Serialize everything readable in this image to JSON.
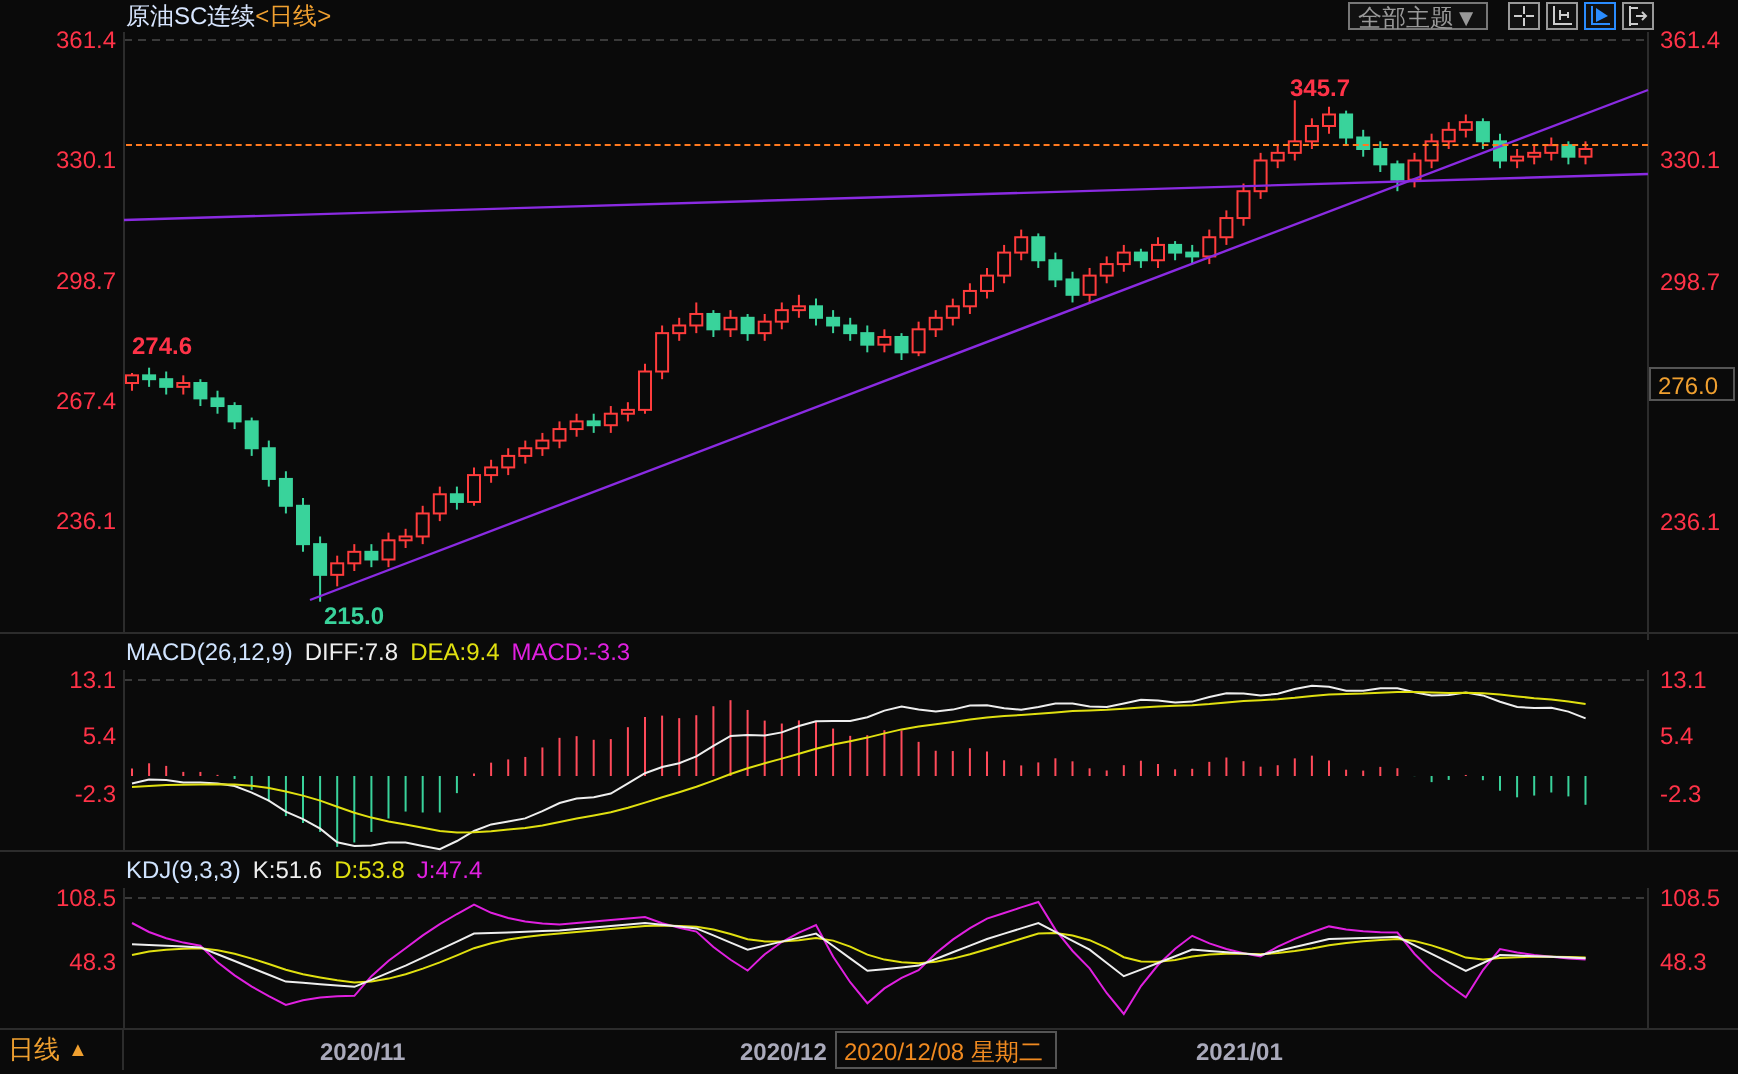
{
  "header": {
    "title": "原油SC连续",
    "period": "<日线>",
    "theme_button": "全部主题▼",
    "tools": [
      {
        "kind": "crosshair",
        "selected": false
      },
      {
        "kind": "axis",
        "selected": false
      },
      {
        "kind": "play",
        "selected": true
      },
      {
        "kind": "shift",
        "selected": false
      }
    ]
  },
  "price_panel": {
    "left_ticks": [
      "361.4",
      "330.1",
      "298.7",
      "267.4",
      "236.1"
    ],
    "right_ticks": [
      "361.4",
      "330.1",
      "298.7",
      "236.1"
    ],
    "current_price": "276.0",
    "chart_data": {
      "type": "candlestick",
      "ylim": [
        207.1,
        363.5
      ],
      "yticks": [
        361.4,
        330.1,
        298.7,
        267.4,
        236.1
      ],
      "ohlc": [
        [
          272,
          274.6,
          270,
          274
        ],
        [
          274,
          276,
          271,
          273
        ],
        [
          273,
          275,
          269,
          271
        ],
        [
          271,
          274,
          269,
          272
        ],
        [
          272,
          273,
          266,
          268
        ],
        [
          268,
          270,
          264,
          266
        ],
        [
          266,
          267,
          260,
          262
        ],
        [
          262,
          263,
          253,
          255
        ],
        [
          255,
          257,
          245,
          247
        ],
        [
          247,
          249,
          238,
          240
        ],
        [
          240,
          242,
          228,
          230
        ],
        [
          230,
          232,
          215,
          222
        ],
        [
          222,
          227,
          219,
          225
        ],
        [
          225,
          230,
          223,
          228
        ],
        [
          228,
          230,
          224,
          226
        ],
        [
          226,
          233,
          224,
          231
        ],
        [
          231,
          234,
          229,
          232
        ],
        [
          232,
          240,
          230,
          238
        ],
        [
          238,
          245,
          236,
          243
        ],
        [
          243,
          245,
          239,
          241
        ],
        [
          241,
          250,
          240,
          248
        ],
        [
          248,
          252,
          246,
          250
        ],
        [
          250,
          255,
          248,
          253
        ],
        [
          253,
          257,
          251,
          255
        ],
        [
          255,
          259,
          253,
          257
        ],
        [
          257,
          262,
          255,
          260
        ],
        [
          260,
          264,
          258,
          262
        ],
        [
          262,
          264,
          259,
          261
        ],
        [
          261,
          266,
          259,
          264
        ],
        [
          264,
          267,
          262,
          265
        ],
        [
          265,
          277,
          264,
          275
        ],
        [
          275,
          287,
          273,
          285
        ],
        [
          285,
          289,
          283,
          287
        ],
        [
          287,
          293,
          285,
          290
        ],
        [
          290,
          291,
          284,
          286
        ],
        [
          286,
          291,
          284,
          289
        ],
        [
          289,
          290,
          283,
          285
        ],
        [
          285,
          290,
          283,
          288
        ],
        [
          288,
          293,
          286,
          291
        ],
        [
          291,
          295,
          289,
          292
        ],
        [
          292,
          294,
          287,
          289
        ],
        [
          289,
          291,
          285,
          287
        ],
        [
          287,
          289,
          283,
          285
        ],
        [
          285,
          287,
          280,
          282
        ],
        [
          282,
          286,
          280,
          284
        ],
        [
          284,
          285,
          278,
          280
        ],
        [
          280,
          288,
          279,
          286
        ],
        [
          286,
          291,
          284,
          289
        ],
        [
          289,
          294,
          287,
          292
        ],
        [
          292,
          298,
          290,
          296
        ],
        [
          296,
          302,
          294,
          300
        ],
        [
          300,
          308,
          298,
          306
        ],
        [
          306,
          312,
          304,
          310
        ],
        [
          310,
          311,
          302,
          304
        ],
        [
          304,
          306,
          297,
          299
        ],
        [
          299,
          301,
          293,
          295
        ],
        [
          295,
          302,
          293,
          300
        ],
        [
          300,
          305,
          298,
          303
        ],
        [
          303,
          308,
          301,
          306
        ],
        [
          306,
          307,
          302,
          304
        ],
        [
          304,
          310,
          302,
          308
        ],
        [
          308,
          309,
          304,
          306
        ],
        [
          306,
          308,
          303,
          305
        ],
        [
          305,
          312,
          303,
          310
        ],
        [
          310,
          317,
          308,
          315
        ],
        [
          315,
          324,
          313,
          322
        ],
        [
          322,
          332,
          320,
          330
        ],
        [
          330,
          334,
          328,
          332
        ],
        [
          332,
          345.7,
          330,
          335
        ],
        [
          335,
          341,
          333,
          339
        ],
        [
          339,
          344,
          337,
          342
        ],
        [
          342,
          343,
          334,
          336
        ],
        [
          336,
          338,
          331,
          333
        ],
        [
          333,
          335,
          327,
          329
        ],
        [
          329,
          330,
          322,
          325
        ],
        [
          325,
          332,
          323,
          330
        ],
        [
          330,
          337,
          328,
          335
        ],
        [
          335,
          340,
          333,
          338
        ],
        [
          338,
          342,
          336,
          340
        ],
        [
          340,
          341,
          333,
          335
        ],
        [
          335,
          337,
          328,
          330
        ],
        [
          330,
          333,
          328,
          331
        ],
        [
          331,
          334,
          329,
          332
        ],
        [
          332,
          336,
          330,
          334
        ],
        [
          334,
          335,
          329,
          331
        ],
        [
          331,
          335,
          329,
          333
        ]
      ]
    },
    "annotations": [
      {
        "text": "345.7",
        "kind": "high"
      },
      {
        "text": "274.6",
        "kind": "high"
      },
      {
        "text": "215.0",
        "kind": "low"
      }
    ]
  },
  "macd_panel": {
    "label": "MACD(26,12,9)",
    "diff": "DIFF:7.8",
    "dea": "DEA:9.4",
    "macd": "MACD:-3.3",
    "left_ticks": [
      "13.1",
      "5.4",
      "-2.3"
    ],
    "right_ticks": [
      "13.1",
      "5.4",
      "-2.3"
    ]
  },
  "kdj_panel": {
    "label": "KDJ(9,3,3)",
    "k": "K:51.6",
    "d": "D:53.8",
    "j": "J:47.4",
    "left_ticks": [
      "108.5",
      "48.3"
    ],
    "right_ticks": [
      "108.5",
      "48.3"
    ]
  },
  "footer": {
    "period": "日线",
    "period_arrow": "▲",
    "x_labels": [
      {
        "text": "2020/11",
        "kind": "month"
      },
      {
        "text": "2020/12",
        "kind": "month"
      },
      {
        "text": "2020/12/08 星期二",
        "kind": "cursor"
      },
      {
        "text": "2021/01",
        "kind": "month"
      }
    ]
  }
}
